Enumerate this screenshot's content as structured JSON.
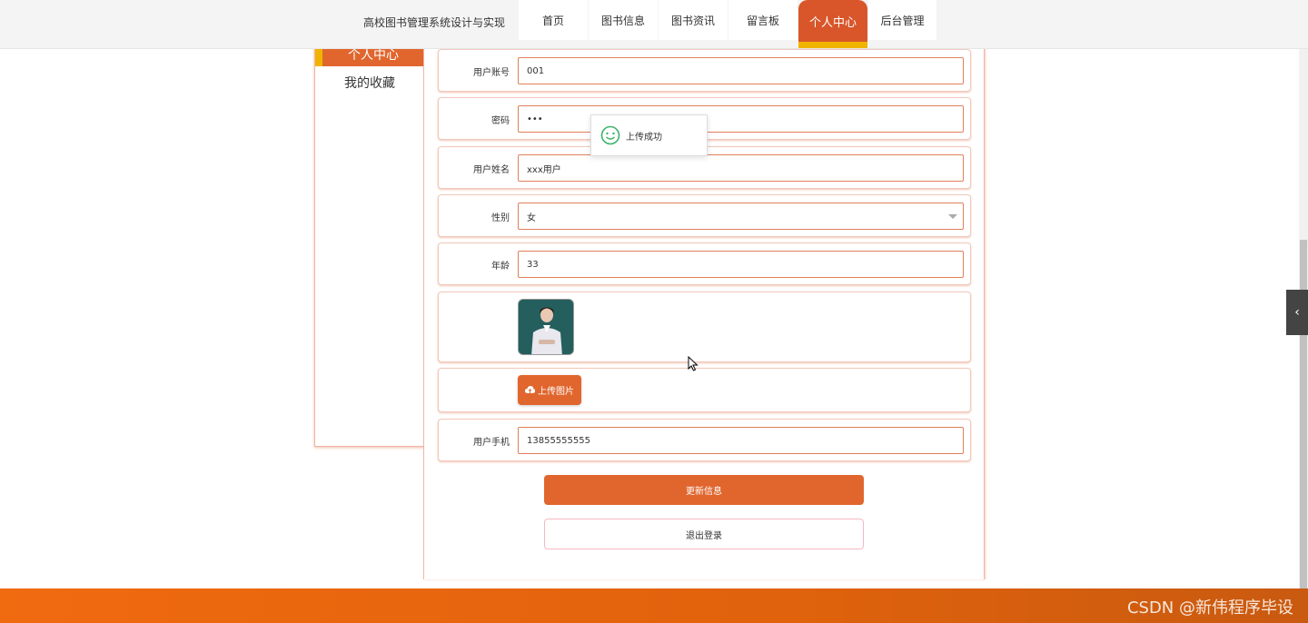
{
  "header": {
    "site_title": "高校图书管理系统设计与实现",
    "nav": [
      "首页",
      "图书信息",
      "图书资讯",
      "留言板",
      "个人中心",
      "后台管理"
    ],
    "active_nav": "个人中心"
  },
  "sidebar": {
    "active_label": "个人中心",
    "items": [
      "我的收藏"
    ]
  },
  "form": {
    "account": {
      "label": "用户账号",
      "value": "001"
    },
    "password": {
      "label": "密码",
      "value": "•••"
    },
    "name": {
      "label": "用户姓名",
      "value": "xxx用户"
    },
    "gender": {
      "label": "性别",
      "value": "女"
    },
    "age": {
      "label": "年龄",
      "value": "33"
    },
    "upload_label": "上传图片",
    "phone": {
      "label": "用户手机",
      "value": "13855555555"
    },
    "update_label": "更新信息",
    "logout_label": "退出登录"
  },
  "toast": {
    "message": "上传成功"
  },
  "footer": {
    "watermark": "CSDN @新伟程序毕设"
  },
  "colors": {
    "accent": "#e0662e",
    "highlight": "#f0b400",
    "footer": "#f06a10"
  },
  "icons": {
    "toast": "smile-icon",
    "upload": "cloud-upload-icon",
    "drawer": "chevron-left-icon"
  }
}
